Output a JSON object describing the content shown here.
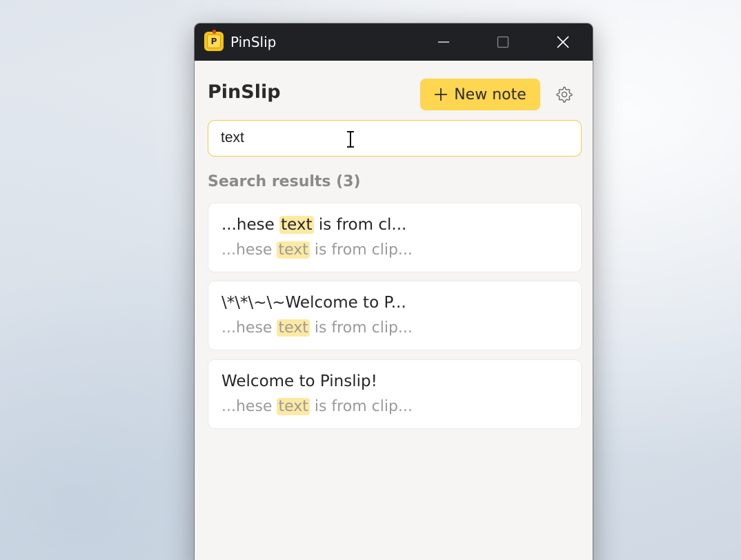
{
  "window": {
    "title": "PinSlip",
    "icon_letter": "P",
    "controls": {
      "minimize": "minimize-icon",
      "maximize": "maximize-icon",
      "close": "close-icon"
    }
  },
  "header": {
    "app_title": "PinSlip",
    "new_note_label": "New note",
    "settings_icon": "gear-icon"
  },
  "search": {
    "value": "text"
  },
  "results": {
    "heading": "Search results (3)",
    "items": [
      {
        "title_pre": "...hese ",
        "title_match": "text",
        "title_post": " is from cl...",
        "snippet_pre": "...hese ",
        "snippet_match": "text",
        "snippet_post": " is from clip..."
      },
      {
        "title": "\\*\\*\\~\\~Welcome to P...",
        "snippet_pre": "...hese ",
        "snippet_match": "text",
        "snippet_post": " is from clip..."
      },
      {
        "title": "Welcome to Pinslip!",
        "snippet_pre": "...hese ",
        "snippet_match": "text",
        "snippet_post": " is from clip..."
      }
    ]
  },
  "colors": {
    "accent": "#ffd650",
    "highlight": "#fde9a2",
    "titlebar": "#202124"
  }
}
